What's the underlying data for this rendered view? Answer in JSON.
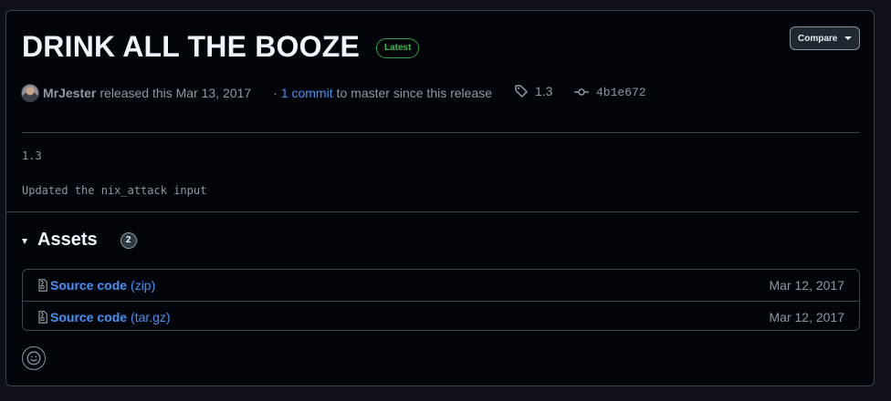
{
  "release": {
    "title": "DRINK ALL THE BOOZE",
    "badge": "Latest",
    "compare_label": "Compare",
    "author": "MrJester",
    "released_text": "released this Mar 13, 2017",
    "commits_prefix": "·",
    "commits_link": "1 commit",
    "commits_suffix": "to master since this release",
    "tag": "1.3",
    "commit_sha": "4b1e672",
    "notes": [
      "1.3",
      "Updated the nix_attack input"
    ]
  },
  "assets": {
    "title": "Assets",
    "count": "2",
    "items": [
      {
        "name": "Source code",
        "type": "(zip)",
        "date": "Mar 12, 2017"
      },
      {
        "name": "Source code",
        "type": "(tar.gz)",
        "date": "Mar 12, 2017"
      }
    ]
  },
  "icons": {
    "tag": "tag-icon",
    "commit": "git-commit-icon",
    "zip": "file-zip-icon",
    "reaction": "smiley-icon",
    "caret": "triangle-down-icon"
  },
  "colors": {
    "background": "#010409",
    "border": "#3d444d",
    "link": "#4493f8",
    "latest": "#3fb950",
    "text": "#f0f6fc",
    "muted": "#9198a1"
  }
}
